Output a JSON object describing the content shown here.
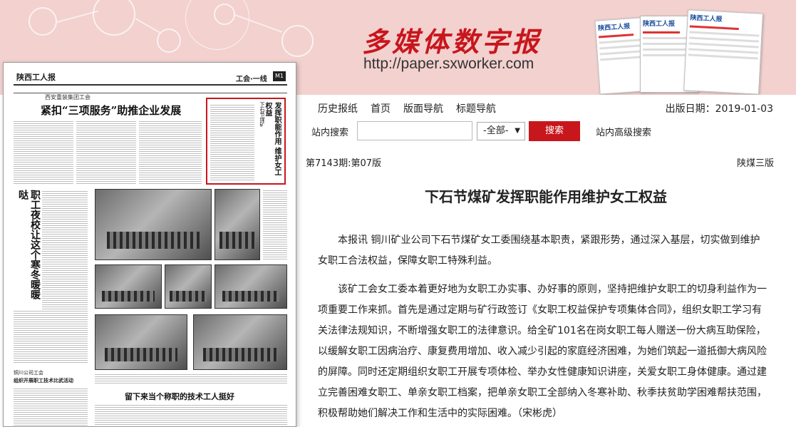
{
  "header": {
    "title": "多媒体数字报",
    "url": "http://paper.sxworker.com"
  },
  "paper_preview": {
    "masthead": "陕西工人报",
    "section": "工会·一线",
    "badge": "M1",
    "kicker": "西安重装集团工会",
    "headline": "紧扣“三项服务”助推企业发展",
    "side_headline": "职工夜校让这个寒冬暖暖哒",
    "highlight_kicker": "下石节煤矿",
    "highlight_headline": "发挥职能作用 维护女工权益",
    "bottom_headline": "留下来当个称职的技术工人挺好",
    "small_head": "组织开展职工技术比武活动",
    "small_kicker": "铜川公司工会"
  },
  "nav": {
    "items": [
      "历史报纸",
      "首页",
      "版面导航",
      "标题导航"
    ],
    "pub_date": "出版日期：2019-01-03"
  },
  "search": {
    "label": "站内搜索",
    "value": "",
    "select_value": "-全部-",
    "button": "搜索",
    "advanced": "站内高级搜索"
  },
  "article": {
    "issue": "第7143期:第07版",
    "edition": "陕煤三版",
    "title": "下石节煤矿发挥职能作用维护女工权益",
    "paragraphs": [
      "本报讯 铜川矿业公司下石节煤矿女工委围绕基本职责，紧跟形势，通过深入基层，切实做到维护女职工合法权益，保障女职工特殊利益。",
      "该矿工会女工委本着更好地为女职工办实事、办好事的原则，坚持把维护女职工的切身利益作为一项重要工作来抓。首先是通过定期与矿行政签订《女职工权益保护专项集体合同》，组织女职工学习有关法律法规知识，不断增强女职工的法律意识。给全矿101名在岗女职工每人赠送一份大病互助保险，以缓解女职工因病治疗、康复费用增加、收入减少引起的家庭经济困难，为她们筑起一道抵御大病风险的屏障。同时还定期组织女职工开展专项体检、举办女性健康知识讲座，关爱女职工身体健康。通过建立完善困难女职工、单亲女职工档案，把单亲女职工全部纳入冬寒补助、秋季扶贫助学困难帮扶范围，积极帮助她们解决工作和生活中的实际困难。（宋彬虎）"
    ]
  },
  "colors": {
    "header_bg": "#f2d1cf",
    "brand_red": "#c8161d"
  },
  "mini_papers": [
    "陕西工人报",
    "陕西工人报",
    "陕西工人报"
  ]
}
